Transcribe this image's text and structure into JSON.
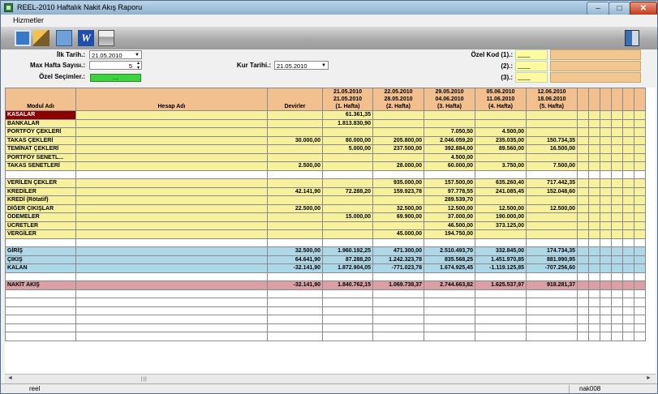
{
  "window": {
    "title": "REEL-2010 Haftalık Nakit Akış Raporu"
  },
  "menu": {
    "items": [
      "Hizmetler"
    ]
  },
  "toolbar": {
    "word_label": "W"
  },
  "form": {
    "ilk_tarih_label": "İlk Tarih.:",
    "ilk_tarih_value": "21.05.2010",
    "max_hafta_label": "Max Hafta Sayısı.:",
    "max_hafta_value": "5",
    "ozel_secimler_label": "Özel Seçimler.:",
    "ozel_secimler_button": "....",
    "kur_tarihi_label": "Kur Tarihi.:",
    "kur_tarihi_value": "21.05.2010",
    "ozel_kod1_label": "Özel Kod (1).:",
    "ozel_kod2_label": "(2).:",
    "ozel_kod3_label": "(3).:",
    "ozel_kod_value": "____"
  },
  "grid": {
    "headers": {
      "modul": "Modul Adı",
      "hesap": "Hesap Adı",
      "devirler": "Devirler",
      "weeks": [
        {
          "l1": "21.05.2010",
          "l2": "21.05.2010",
          "l3": "(1. Hafta)"
        },
        {
          "l1": "22.05.2010",
          "l2": "28.05.2010",
          "l3": "(2. Hafta)"
        },
        {
          "l1": "29.05.2010",
          "l2": "04.06.2010",
          "l3": "(3. Hafta)"
        },
        {
          "l1": "05.06.2010",
          "l2": "11.06.2010",
          "l3": "(4. Hafta)"
        },
        {
          "l1": "12.06.2010",
          "l2": "18.06.2010",
          "l3": "(5. Hafta)"
        }
      ]
    },
    "rows": [
      {
        "name": "KASALAR",
        "dev": "",
        "w": [
          "61.361,35",
          "",
          "",
          "",
          ""
        ],
        "style": "kasalar"
      },
      {
        "name": "BANKALAR",
        "dev": "",
        "w": [
          "1.813.830,90",
          "",
          "",
          "",
          ""
        ]
      },
      {
        "name": "PORTFÖY ÇEKLERİ",
        "dev": "",
        "w": [
          "",
          "",
          "7.050,50",
          "4.500,00",
          ""
        ]
      },
      {
        "name": "TAKAS ÇEKLERİ",
        "dev": "30.000,00",
        "w": [
          "80.000,00",
          "205.800,00",
          "2.046.059,20",
          "235.035,00",
          "150.734,35"
        ]
      },
      {
        "name": "TEMİNAT ÇEKLERİ",
        "dev": "",
        "w": [
          "5.000,00",
          "237.500,00",
          "392.884,00",
          "89.560,00",
          "16.500,00"
        ]
      },
      {
        "name": "PORTFÖY SENETL...",
        "dev": "",
        "w": [
          "",
          "",
          "4.500,00",
          "",
          ""
        ]
      },
      {
        "name": "TAKAS SENETLERİ",
        "dev": "2.500,00",
        "w": [
          "",
          "28.000,00",
          "60.000,00",
          "3.750,00",
          "7.500,00"
        ]
      },
      {
        "name": "",
        "dev": "",
        "w": [
          "",
          "",
          "",
          "",
          ""
        ],
        "style": "gap"
      },
      {
        "name": "VERİLEN ÇEKLER",
        "dev": "",
        "w": [
          "",
          "935.000,00",
          "157.500,00",
          "635.260,40",
          "717.442,35"
        ]
      },
      {
        "name": "KREDİLER",
        "dev": "42.141,90",
        "w": [
          "72.288,20",
          "159.923,78",
          "97.778,55",
          "241.085,45",
          "152.048,60"
        ]
      },
      {
        "name": "KREDİ (Rötatif)",
        "dev": "",
        "w": [
          "",
          "",
          "289.539,70",
          "",
          ""
        ]
      },
      {
        "name": "DİĞER ÇIKIŞLAR",
        "dev": "22.500,00",
        "w": [
          "",
          "32.500,00",
          "12.500,00",
          "12.500,00",
          "12.500,00"
        ]
      },
      {
        "name": "ÖDEMELER",
        "dev": "",
        "w": [
          "15.000,00",
          "69.900,00",
          "37.000,00",
          "190.000,00",
          ""
        ]
      },
      {
        "name": "ÜCRETLER",
        "dev": "",
        "w": [
          "",
          "",
          "46.500,00",
          "373.125,00",
          ""
        ]
      },
      {
        "name": "VERGİLER",
        "dev": "",
        "w": [
          "",
          "45.000,00",
          "194.750,00",
          "",
          ""
        ]
      },
      {
        "name": "",
        "dev": "",
        "w": [
          "",
          "",
          "",
          "",
          ""
        ],
        "style": "gap"
      },
      {
        "name": "GİRİŞ",
        "dev": "32.500,00",
        "w": [
          "1.960.192,25",
          "471.300,00",
          "2.510.493,70",
          "332.845,00",
          "174.734,35"
        ],
        "style": "blue"
      },
      {
        "name": "ÇIKIŞ",
        "dev": "64.641,90",
        "w": [
          "87.288,20",
          "1.242.323,78",
          "835.568,25",
          "1.451.970,85",
          "881.990,95"
        ],
        "style": "blue"
      },
      {
        "name": "KALAN",
        "dev": "-32.141,90",
        "w": [
          "1.872.904,05",
          "-771.023,78",
          "1.674.925,45",
          "-1.119.125,85",
          "-707.256,60"
        ],
        "style": "blue"
      },
      {
        "name": "",
        "dev": "",
        "w": [
          "",
          "",
          "",
          "",
          ""
        ],
        "style": "gap"
      },
      {
        "name": "NAKİT AKIŞ",
        "dev": "-32.141,90",
        "w": [
          "1.840.762,15",
          "1.069.738,37",
          "2.744.663,82",
          "1.625.537,97",
          "918.281,37"
        ],
        "style": "rose"
      }
    ]
  },
  "status": {
    "left": "reel",
    "right": "nak008"
  }
}
